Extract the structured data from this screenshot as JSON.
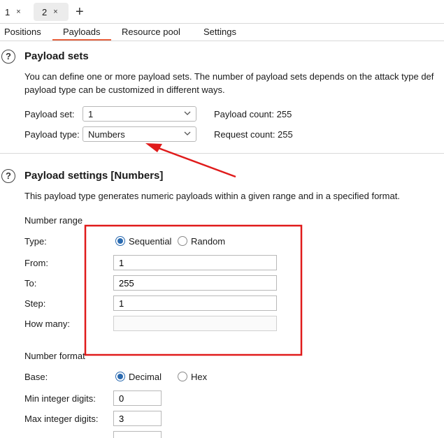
{
  "top_tabs": [
    {
      "label": "1",
      "close": "×"
    },
    {
      "label": "2",
      "close": "×"
    }
  ],
  "add_tab": "+",
  "sub_tabs": [
    "Positions",
    "Payloads",
    "Resource pool",
    "Settings"
  ],
  "active_sub_tab": "Payloads",
  "payload_sets": {
    "help": "?",
    "title": "Payload sets",
    "desc_line1": "You can define one or more payload sets. The number of payload sets depends on the attack type def",
    "desc_line2": "payload type can be customized in different ways.",
    "payload_set_label": "Payload set:",
    "payload_set_value": "1",
    "payload_type_label": "Payload type:",
    "payload_type_value": "Numbers",
    "payload_count": "Payload count: 255",
    "request_count": "Request count: 255"
  },
  "payload_settings": {
    "help": "?",
    "title": "Payload settings [Numbers]",
    "desc": "This payload type generates numeric payloads within a given range and in a specified format.",
    "number_range_label": "Number range",
    "type_label": "Type:",
    "type_options": [
      "Sequential",
      "Random"
    ],
    "type_selected": "Sequential",
    "from_label": "From:",
    "from_value": "1",
    "to_label": "To:",
    "to_value": "255",
    "step_label": "Step:",
    "step_value": "1",
    "how_many_label": "How many:",
    "how_many_value": "",
    "number_format_label": "Number format",
    "base_label": "Base:",
    "base_options": [
      "Decimal",
      "Hex"
    ],
    "base_selected": "Decimal",
    "min_int_label": "Min integer digits:",
    "min_int_value": "0",
    "max_int_label": "Max integer digits:",
    "max_int_value": "3"
  },
  "colors": {
    "accent_underline": "#e8603c",
    "annotation_red": "#e01b1b",
    "radio_selected": "#2a6ab0"
  }
}
